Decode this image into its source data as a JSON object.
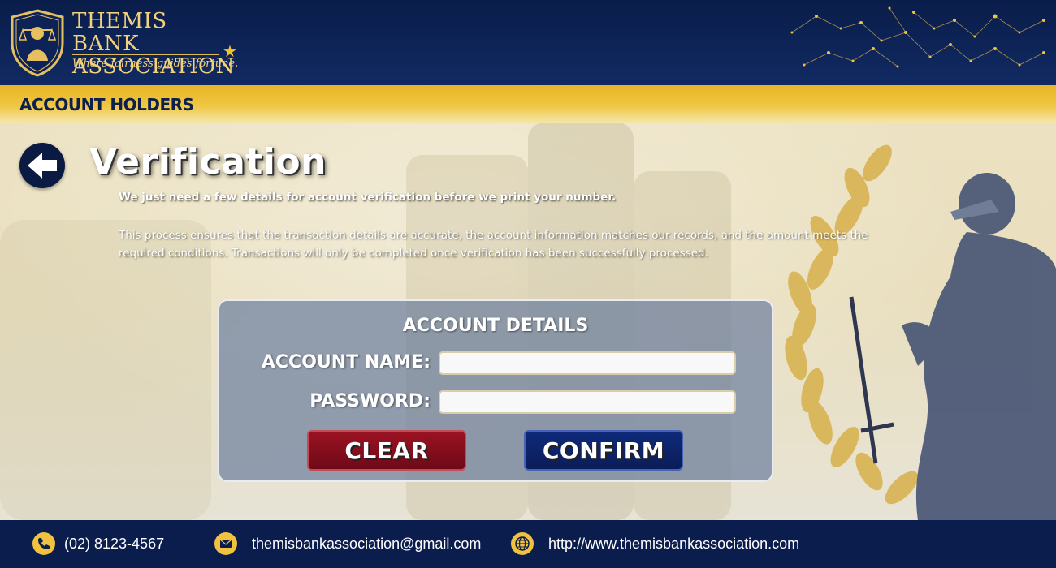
{
  "header": {
    "brand_title": "THEMIS BANK ASSOCIATION",
    "brand_tagline": "Where fairness guides fortune."
  },
  "section": {
    "title": "ACCOUNT HOLDERS"
  },
  "page": {
    "heading": "Verification",
    "intro_bold": "We just need a few details for account verification before we print your number.",
    "intro_text": "This process ensures that the transaction details are accurate, the account information matches our records, and the amount meets the required conditions. Transactions will only be completed once verification has been successfully processed."
  },
  "form": {
    "heading": "ACCOUNT DETAILS",
    "account_name_label": "ACCOUNT NAME:",
    "account_name_value": "",
    "password_label": "PASSWORD:",
    "password_value": "",
    "clear_label": "CLEAR",
    "confirm_label": "CONFIRM"
  },
  "footer": {
    "phone": "(02) 8123-4567",
    "email": "themisbankassociation@gmail.com",
    "website": "http://www.themisbankassociation.com"
  },
  "colors": {
    "navy": "#0b1d4d",
    "gold": "#f0c23d",
    "clear_button": "#8a0f1e",
    "confirm_button": "#0f2a7a"
  },
  "icons": {
    "back": "arrow-left-icon",
    "phone": "phone-icon",
    "email": "envelope-icon",
    "website": "globe-icon",
    "logo": "themis-shield-logo"
  }
}
